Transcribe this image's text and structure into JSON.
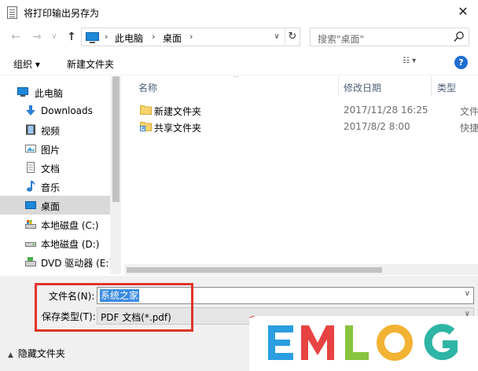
{
  "window": {
    "title": "将打印输出另存为",
    "close_glyph": "✕"
  },
  "navigation": {
    "back_glyph": "←",
    "forward_glyph": "→",
    "recent_glyph": "∨",
    "up_glyph": "↑",
    "breadcrumbs": [
      "此电脑",
      "桌面"
    ],
    "breadcrumb_sep": "›",
    "address_dropdown_glyph": "∨",
    "refresh_glyph": "↻",
    "search_placeholder": "搜索\"桌面\""
  },
  "toolbar": {
    "organize_label": "组织 ▾",
    "new_folder_label": "新建文件夹",
    "view_glyph": "☷ ▾",
    "help_glyph": "?"
  },
  "sidebar": {
    "items": [
      {
        "label": "此电脑",
        "icon": "computer-icon"
      },
      {
        "label": "Downloads",
        "icon": "download-icon"
      },
      {
        "label": "视频",
        "icon": "video-icon"
      },
      {
        "label": "图片",
        "icon": "picture-icon"
      },
      {
        "label": "文档",
        "icon": "document-icon"
      },
      {
        "label": "音乐",
        "icon": "music-icon"
      },
      {
        "label": "桌面",
        "icon": "desktop-icon",
        "selected": true
      },
      {
        "label": "本地磁盘 (C:)",
        "icon": "drive-icon"
      },
      {
        "label": "本地磁盘 (D:)",
        "icon": "drive-icon"
      },
      {
        "label": "DVD 驱动器 (E:)",
        "icon": "dvd-icon"
      }
    ]
  },
  "file_list": {
    "columns": {
      "name": "名称",
      "modified": "修改日期",
      "type": "类型"
    },
    "sort_glyph": "^",
    "rows": [
      {
        "name": "新建文件夹",
        "modified": "2017/11/28 16:25",
        "type": "文件夹",
        "icon": "folder-icon"
      },
      {
        "name": "共享文件夹",
        "modified": "2017/8/2 8:00",
        "type": "快捷方式",
        "icon": "shortcut-folder-icon"
      }
    ]
  },
  "save_form": {
    "filename_label": "文件名(N):",
    "filename_value": "系统之家",
    "filetype_label": "保存类型(T):",
    "filetype_value": "PDF 文档(*.pdf)",
    "dropdown_glyph": "∨",
    "hide_folders_label": "隐藏文件夹",
    "hide_folders_caret": "▲"
  },
  "watermark": {
    "text": "EMLOG",
    "colors": [
      "#2a9ee0",
      "#e84343",
      "#88c43d",
      "#f2b233",
      "#2fb5a5"
    ]
  }
}
